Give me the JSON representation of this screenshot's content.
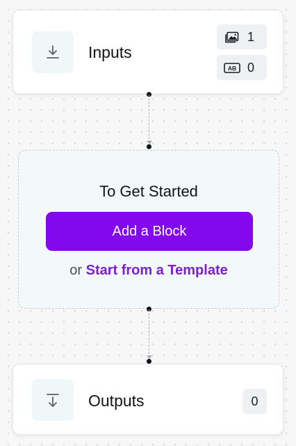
{
  "inputs_node": {
    "title": "Inputs",
    "icon": "download-arrow-icon",
    "badges": [
      {
        "icon": "image-icon",
        "count": "1"
      },
      {
        "icon": "text-ab-icon",
        "count": "0"
      }
    ]
  },
  "get_started": {
    "heading": "To Get Started",
    "add_block_label": "Add a Block",
    "or_text": "or",
    "template_link": "Start from a Template"
  },
  "outputs_node": {
    "title": "Outputs",
    "icon": "output-arrow-icon",
    "count": "0"
  },
  "colors": {
    "accent": "#8308ee",
    "link": "#7a1fd1",
    "canvas": "#f7f7f8",
    "icon_tile": "#f0f7f8"
  }
}
